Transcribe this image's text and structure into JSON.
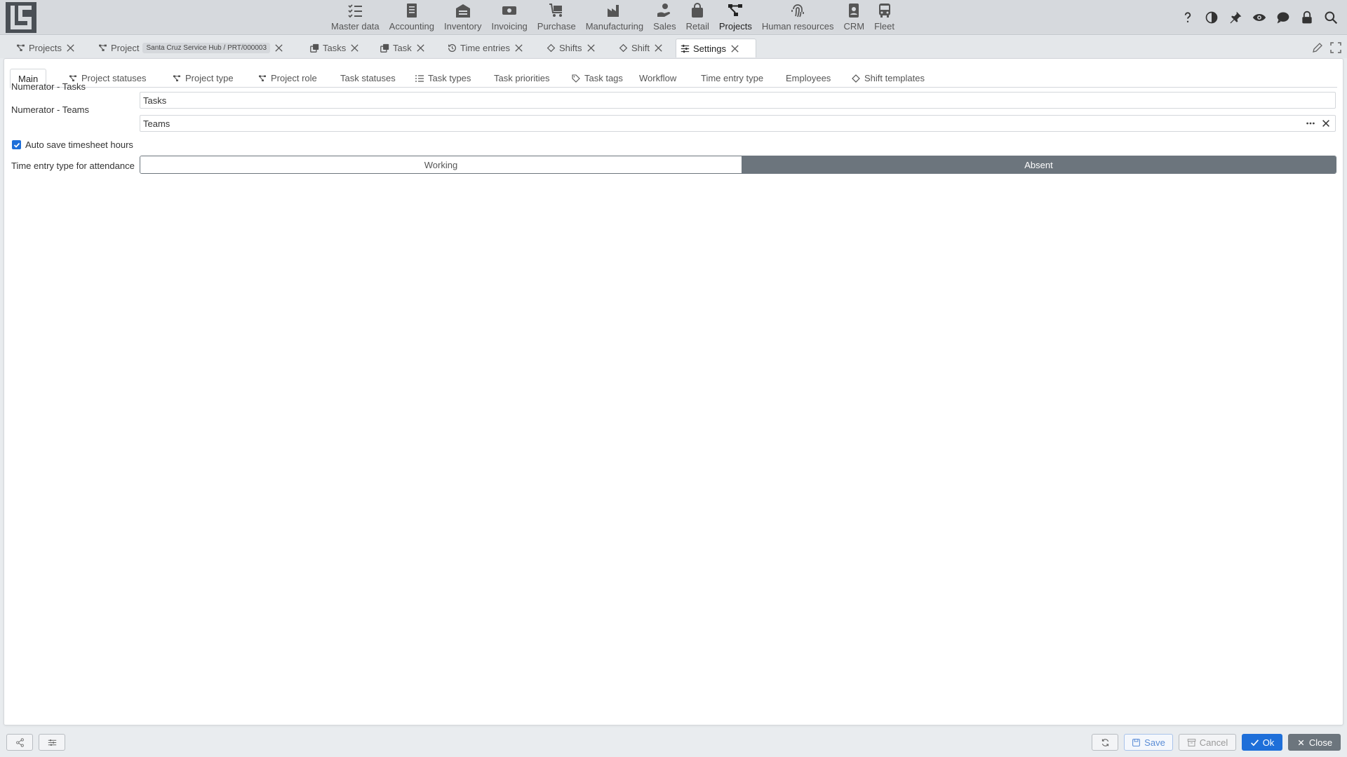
{
  "nav": {
    "modules": [
      {
        "label": "Master data",
        "icon": "list-check-icon"
      },
      {
        "label": "Accounting",
        "icon": "ledger-icon"
      },
      {
        "label": "Inventory",
        "icon": "warehouse-icon"
      },
      {
        "label": "Invoicing",
        "icon": "money-icon"
      },
      {
        "label": "Purchase",
        "icon": "cart-icon"
      },
      {
        "label": "Manufacturing",
        "icon": "factory-icon"
      },
      {
        "label": "Sales",
        "icon": "hand-money-icon"
      },
      {
        "label": "Retail",
        "icon": "bag-icon"
      },
      {
        "label": "Projects",
        "icon": "project-diagram-icon",
        "active": true
      },
      {
        "label": "Human resources",
        "icon": "fingerprint-icon"
      },
      {
        "label": "CRM",
        "icon": "contact-book-icon"
      },
      {
        "label": "Fleet",
        "icon": "bus-icon"
      }
    ],
    "right_icons": [
      "help-icon",
      "contrast-icon",
      "pin-icon",
      "eye-icon",
      "chat-icon",
      "lock-icon",
      "search-icon"
    ]
  },
  "doc_tabs": {
    "projects": "Projects",
    "project": "Project",
    "project_pill": "Santa Cruz Service Hub / PRT/000003",
    "tasks": "Tasks",
    "task": "Task",
    "time_entries": "Time entries",
    "shifts": "Shifts",
    "shift": "Shift",
    "settings": "Settings"
  },
  "subtabs": {
    "main": "Main",
    "project_statuses": "Project statuses",
    "project_type": "Project type",
    "project_role": "Project role",
    "task_statuses": "Task statuses",
    "task_types": "Task types",
    "task_priorities": "Task priorities",
    "task_tags": "Task tags",
    "workflow": "Workflow",
    "time_entry_type": "Time entry type",
    "employees": "Employees",
    "shift_templates": "Shift templates"
  },
  "form": {
    "numerator_tasks_label": "Numerator - Tasks",
    "numerator_tasks_value": "Tasks",
    "numerator_teams_label": "Numerator - Teams",
    "numerator_teams_value": "Teams",
    "auto_save_label": "Auto save timesheet hours",
    "auto_save_checked": true,
    "attendance_label": "Time entry type for attendance",
    "attendance_options": [
      "Working",
      "Absent"
    ],
    "attendance_selected": "Absent"
  },
  "bottom": {
    "save": "Save",
    "cancel": "Cancel",
    "ok": "Ok",
    "close": "Close"
  },
  "colors": {
    "primary": "#1e6fd9",
    "secondary": "#6c757d",
    "topbar": "#d6d9dd"
  }
}
